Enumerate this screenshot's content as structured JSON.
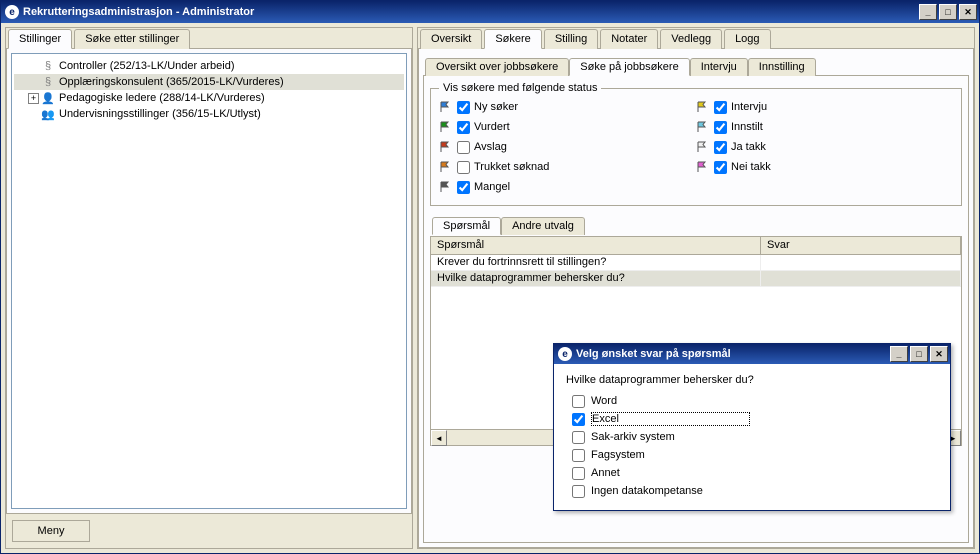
{
  "window_title": "Rekrutteringsadministrasjon - Administrator",
  "left": {
    "tabs": [
      {
        "label": "Stillinger",
        "active": true
      },
      {
        "label": "Søke etter stillinger",
        "active": false
      }
    ],
    "tree": [
      {
        "label": "Controller (252/13-LK/Under arbeid)",
        "icon": "doc",
        "indent": 1
      },
      {
        "label": "Opplæringskonsulent (365/2015-LK/Vurderes)",
        "icon": "doc",
        "indent": 1,
        "selected": true
      },
      {
        "label": "Pedagogiske ledere (288/14-LK/Vurderes)",
        "icon": "person",
        "indent": 1,
        "expand": "+"
      },
      {
        "label": "Undervisningsstillinger (356/15-LK/Utlyst)",
        "icon": "people",
        "indent": 1
      }
    ],
    "meny_label": "Meny"
  },
  "right": {
    "main_tabs": [
      {
        "label": "Oversikt",
        "active": false
      },
      {
        "label": "Søkere",
        "active": true
      },
      {
        "label": "Stilling",
        "active": false
      },
      {
        "label": "Notater",
        "active": false
      },
      {
        "label": "Vedlegg",
        "active": false
      },
      {
        "label": "Logg",
        "active": false
      }
    ],
    "sub_tabs": [
      {
        "label": "Oversikt over jobbsøkere",
        "active": false
      },
      {
        "label": "Søke på jobbsøkere",
        "active": true
      },
      {
        "label": "Intervju",
        "active": false
      },
      {
        "label": "Innstilling",
        "active": false
      }
    ],
    "status_group_title": "Vis søkere med følgende status",
    "status_left": [
      {
        "label": "Ny søker",
        "checked": true,
        "color": "#2e7dd6"
      },
      {
        "label": "Vurdert",
        "checked": true,
        "color": "#1a8f1a"
      },
      {
        "label": "Avslag",
        "checked": false,
        "color": "#c43b1d"
      },
      {
        "label": "Trukket søknad",
        "checked": false,
        "color": "#d67a1c"
      },
      {
        "label": "Mangel",
        "checked": true,
        "color": "#555555"
      }
    ],
    "status_right": [
      {
        "label": "Intervju",
        "checked": true,
        "color": "#e0c81c"
      },
      {
        "label": "Innstilt",
        "checked": true,
        "color": "#6ec8e0"
      },
      {
        "label": "Ja takk",
        "checked": true,
        "color": "#f0f0f0"
      },
      {
        "label": "Nei takk",
        "checked": true,
        "color": "#e060d0"
      }
    ],
    "inner_tabs": [
      {
        "label": "Spørsmål",
        "active": true
      },
      {
        "label": "Andre utvalg",
        "active": false
      }
    ],
    "qtable": {
      "headers": {
        "q": "Spørsmål",
        "a": "Svar"
      },
      "rows": [
        {
          "q": "Krever du fortrinnsrett til stillingen?",
          "a": "",
          "selected": false
        },
        {
          "q": "Hvilke dataprogrammer behersker du?",
          "a": "",
          "selected": true
        }
      ]
    }
  },
  "dialog": {
    "title": "Velg ønsket svar på spørsmål",
    "question": "Hvilke dataprogrammer behersker du?",
    "options": [
      {
        "label": "Word",
        "checked": false
      },
      {
        "label": "Excel",
        "checked": true,
        "selected": true
      },
      {
        "label": "Sak-arkiv system",
        "checked": false
      },
      {
        "label": "Fagsystem",
        "checked": false
      },
      {
        "label": "Annet",
        "checked": false
      },
      {
        "label": "Ingen datakompetanse",
        "checked": false
      }
    ]
  }
}
